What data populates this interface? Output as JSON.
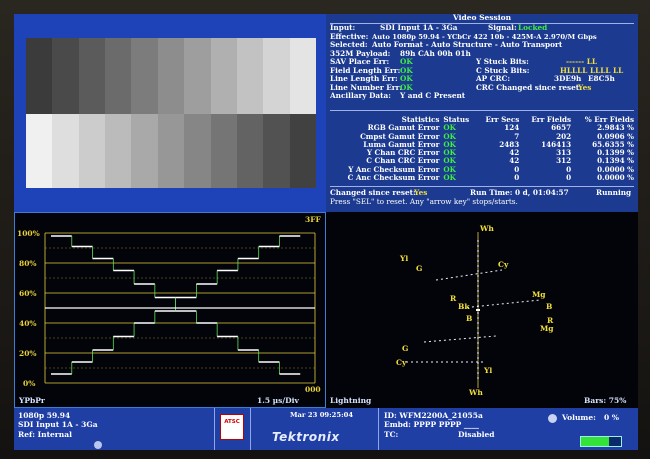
{
  "colors": {
    "blue_panel": "#1c3a8f",
    "ok_green": "#3ef03e",
    "value_yellow": "#f3e03a",
    "trace": "#ffffff",
    "graticule_yellow": "#e5cf3d"
  },
  "picture": {
    "top_bars": [
      "#3b3b3b",
      "#4a4a4a",
      "#5b5b5b",
      "#6b6b6b",
      "#7c7c7c",
      "#8d8d8d",
      "#9e9e9e",
      "#b0b0b0",
      "#c2c2c2",
      "#d4d4d4",
      "#e4e4e4"
    ],
    "bottom_bars": [
      "#f0f0f0",
      "#dedede",
      "#cccccc",
      "#bbbbbb",
      "#a9a9a9",
      "#979797",
      "#868686",
      "#757575",
      "#636363",
      "#525252",
      "#414141"
    ]
  },
  "video_session": {
    "title": "Video Session",
    "input_label": "Input:",
    "input_value": "SDI Input 1A - 3Ga",
    "signal_label": "Signal:",
    "signal_value": "Locked",
    "effective_label": "Effective:",
    "effective_value": "Auto 1080p 59.94 - YCbCr 422 10b - 425M-A 2.970/M Gbps",
    "selected_label": "Selected:",
    "selected_value": "Auto Format - Auto Structure - Auto Transport",
    "payload_label": "352M Payload:",
    "payload_value": "89h CAh 00h 01h",
    "sav_label": "SAV Place Err:",
    "sav_value": "OK",
    "field_label": "Field Length Err:",
    "field_value": "OK",
    "line_label": "Line Length Err:",
    "line_value": "OK",
    "linenum_label": "Line Number Err:",
    "linenum_value": "OK",
    "anc_label": "Ancillary Data:",
    "anc_value": "Y and C Present",
    "ystuck_label": "Y Stuck Bits:",
    "ystuck_value": "------ LL",
    "cstuck_label": "C Stuck Bits:",
    "cstuck_value": "HLLLL LLLL LL",
    "apcrc_label": "AP CRC:",
    "apcrc_value1": "3DE9h",
    "apcrc_value2": "E8C5h",
    "crc_changed_label": "CRC Changed since reset:",
    "crc_changed_value": "Yes",
    "stats_headers": [
      "Statistics",
      "Status",
      "Err Secs",
      "Err Fields",
      "% Err Fields"
    ],
    "stats_rows": [
      [
        "RGB Gamut Error",
        "OK",
        "124",
        "6657",
        "2.9843 %"
      ],
      [
        "Cmpst Gamut Error",
        "OK",
        "7",
        "202",
        "0.0906 %"
      ],
      [
        "Luma Gamut Error",
        "OK",
        "2483",
        "146413",
        "65.6355 %"
      ],
      [
        "Y Chan CRC Error",
        "OK",
        "42",
        "313",
        "0.1399 %"
      ],
      [
        "C Chan CRC Error",
        "OK",
        "42",
        "312",
        "0.1394 %"
      ],
      [
        "Y Anc Checksum Error",
        "OK",
        "0",
        "0",
        "0.0000 %"
      ],
      [
        "C Anc Checksum Error",
        "OK",
        "0",
        "0",
        "0.0000 %"
      ]
    ],
    "changed_label": "Changed since reset:",
    "changed_value": "Yes",
    "runtime_label": "Run Time: 0 d, 01:04:57",
    "running": "Running",
    "hint": "Press \"SEL\" to reset.   Any \"arrow key\" stops/starts."
  },
  "waveform": {
    "percent_labels": [
      "100%",
      "80%",
      "60%",
      "40%",
      "20%",
      "0%"
    ],
    "top_right": "3FF",
    "bottom_right": "000",
    "mode_label": "YPbPr",
    "scale_label": "1.5 µs/Div",
    "steps_level": [
      0.98,
      0.91,
      0.83,
      0.75,
      0.66,
      0.57,
      0.48,
      0.4,
      0.31,
      0.22,
      0.14,
      0.06
    ]
  },
  "lightning": {
    "top_label": "Wh",
    "bottom_label": "Wh",
    "mode_label": "Lightning",
    "bars_label": "Bars: 75%",
    "targets": [
      "Yl",
      "G",
      "Cy",
      "R",
      "Bk",
      "B",
      "Mg",
      "B",
      "R",
      "Mg",
      "G",
      "Cy",
      "Yl"
    ]
  },
  "status_bar": {
    "format": "1080p 59.94",
    "input": "SDI Input 1A - 3Ga",
    "ref": "Ref: Internal",
    "logo_text": "ATSC",
    "date": "Mar 23 09:25:04",
    "brand": "Tektronix",
    "id": "ID: WFM2200A_21055a",
    "embd": "Embd: PPPP PPPP ____",
    "tc_label": "TC:",
    "tc_value": "Disabled",
    "volume_label": "Volume:",
    "volume_value": "0 %"
  }
}
